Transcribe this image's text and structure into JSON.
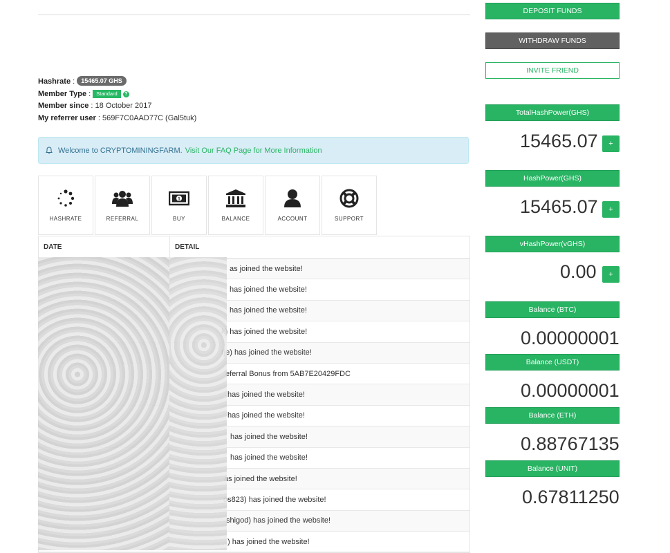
{
  "profile": {
    "hashrate_label": "Hashrate",
    "hashrate_value": "15465.07 GHS",
    "member_type_label": "Member Type",
    "member_type_value": "Standard",
    "member_since_label": "Member since",
    "member_since_value": "18 October 2017",
    "referrer_label": "My referrer user",
    "referrer_value": "569F7C0AAD77C (Gal5tuk)"
  },
  "alert": {
    "text": "Welcome to CRYPTOMININGFARM.",
    "link": "Visit Our FAQ Page for More Information"
  },
  "tiles": [
    {
      "label": "HASHRATE",
      "icon": "spinner-icon"
    },
    {
      "label": "REFERRAL",
      "icon": "users-icon"
    },
    {
      "label": "BUY",
      "icon": "money-icon"
    },
    {
      "label": "BALANCE",
      "icon": "bank-icon"
    },
    {
      "label": "ACCOUNT",
      "icon": "user-icon"
    },
    {
      "label": "SUPPORT",
      "icon": "lifebuoy-icon"
    }
  ],
  "table": {
    "headers": [
      "DATE",
      "DETAIL"
    ],
    "rows": [
      "as joined the website!",
      "has joined the website!",
      "has joined the website!",
      "k) has joined the website!",
      "rje) has joined the website!",
      "eferral Bonus from 5AB7E20429FDC",
      "has joined the website!",
      "has joined the website!",
      "has joined the website!",
      "has joined the website!",
      "as joined the website!",
      "os823) has joined the website!",
      "shigod) has joined the website!",
      ") has joined the website!"
    ]
  },
  "sidebar": {
    "deposit": "DEPOSIT FUNDS",
    "withdraw": "WITHDRAW FUNDS",
    "invite": "INVITE FRIEND",
    "total_hash_label": "TotalHashPower(GHS)",
    "total_hash_value": "15465.07",
    "hash_label": "HashPower(GHS)",
    "hash_value": "15465.07",
    "vhash_label": "vHashPower(vGHS)",
    "vhash_value": "0.00",
    "plus": "+",
    "btc_label": "Balance (BTC)",
    "btc_value": "0.00000001",
    "usdt_label": "Balance (USDT)",
    "usdt_value": "0.00000001",
    "eth_label": "Balance (ETH)",
    "eth_value": "0.88767135",
    "unit_label": "Balance (UNIT)",
    "unit_value": "0.67811250"
  },
  "colors": {
    "accent": "#28b463",
    "grey_button": "#616161",
    "alert_bg": "#d9edf7"
  }
}
